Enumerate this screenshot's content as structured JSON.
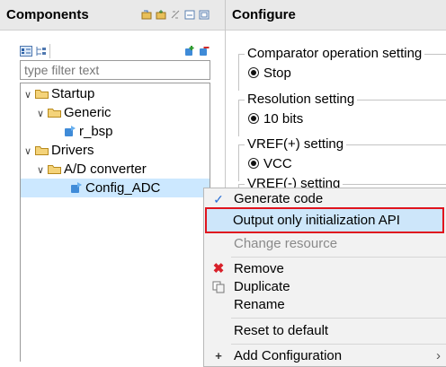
{
  "components": {
    "title": "Components",
    "filter_placeholder": "type filter text",
    "tree": {
      "startup": "Startup",
      "generic": "Generic",
      "r_bsp": "r_bsp",
      "drivers": "Drivers",
      "ad_converter": "A/D converter",
      "config_adc": "Config_ADC"
    }
  },
  "configure": {
    "title": "Configure",
    "groups": [
      {
        "legend": "Comparator operation setting",
        "value": "Stop"
      },
      {
        "legend": "Resolution setting",
        "value": "10 bits"
      },
      {
        "legend": "VREF(+) setting",
        "value": "VCC"
      },
      {
        "legend": "VREF(-) setting"
      }
    ]
  },
  "context_menu": {
    "generate_code": "Generate code",
    "output_only": "Output only initialization API",
    "change_resource": "Change resource",
    "remove": "Remove",
    "duplicate": "Duplicate",
    "rename": "Rename",
    "reset_to_default": "Reset to default",
    "add_configuration": "Add Configuration"
  },
  "colors": {
    "highlight_border": "#e0141e",
    "selection": "#cce8ff"
  }
}
